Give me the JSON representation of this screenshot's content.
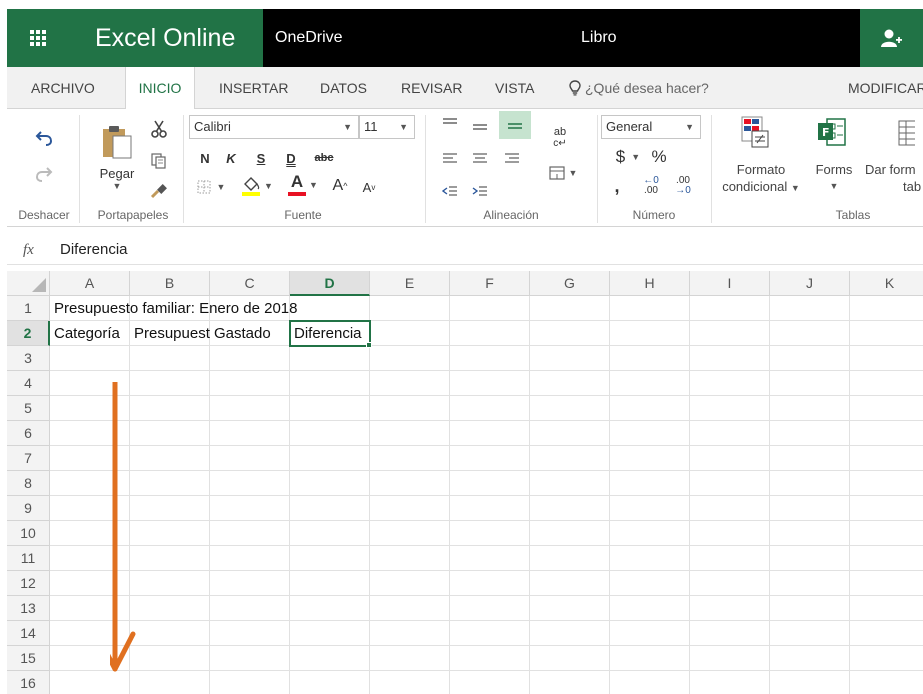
{
  "titlebar": {
    "app_name": "Excel Online",
    "location": "OneDrive",
    "document": "Libro"
  },
  "ribbon_tabs": [
    "ARCHIVO",
    "INICIO",
    "INSERTAR",
    "DATOS",
    "REVISAR",
    "VISTA",
    "MODIFICAR"
  ],
  "active_tab": "INICIO",
  "tell_me": "¿Qué desea hacer?",
  "ribbon": {
    "groups": {
      "undo": "Deshacer",
      "clipboard": "Portapapeles",
      "font": "Fuente",
      "alignment": "Alineación",
      "number": "Número",
      "tables": "Tablas"
    },
    "paste_label": "Pegar",
    "font_name": "Calibri",
    "font_size": "11",
    "bold": "N",
    "italic": "K",
    "underline": "S",
    "double_underline": "D",
    "strikethrough": "abc",
    "font_color_letter": "A",
    "grow_font": "A",
    "shrink_font": "A",
    "number_format": "General",
    "currency": "$",
    "percent": "%",
    "comma": ",",
    "increase_decimal": ".00",
    "decrease_decimal": ".00",
    "conditional_format_label_1": "Formato",
    "conditional_format_label_2": "condicional",
    "forms_label": "Forms",
    "format_table_label_1": "Dar form",
    "format_table_label_2": "tab",
    "wrap_text": "ab",
    "accent_color": "#217346",
    "highlight_color": "#ffff00",
    "font_color": "#e81123"
  },
  "formula_bar": {
    "fx_label": "fx",
    "value": "Diferencia"
  },
  "grid": {
    "columns": [
      "A",
      "B",
      "C",
      "D",
      "E",
      "F",
      "G",
      "H",
      "I",
      "J",
      "K"
    ],
    "rows": [
      "1",
      "2",
      "3",
      "4",
      "5",
      "6",
      "7",
      "8",
      "9",
      "10",
      "11",
      "12",
      "13",
      "14",
      "15",
      "16"
    ],
    "selected_column": "D",
    "selected_row": "2",
    "cells": {
      "A1": "Presupuesto familiar: Enero de 2018",
      "A2": "Categoría",
      "B2": "Presupuesto",
      "C2": "Gastado",
      "D2": "Diferencia"
    },
    "annotation_color": "#e07020"
  }
}
